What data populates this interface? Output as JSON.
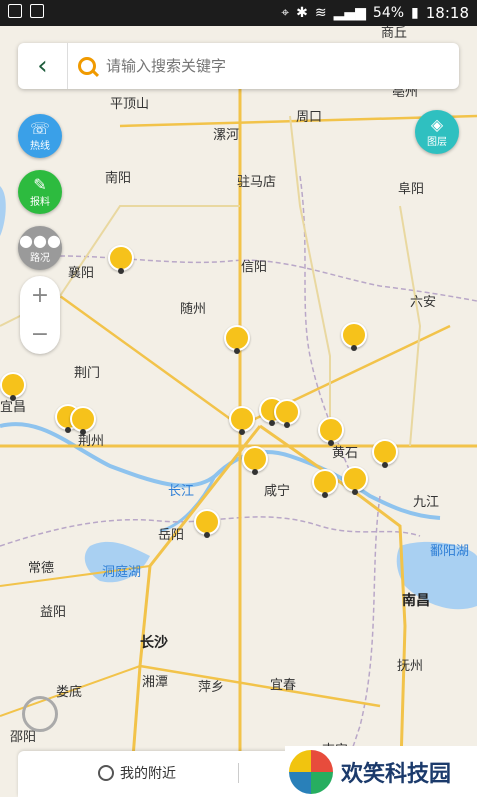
{
  "status_bar": {
    "battery": "54%",
    "time": "18:18"
  },
  "search": {
    "back_icon": "chevron-left-icon",
    "placeholder": "请输入搜索关键字"
  },
  "fabs": {
    "hotline": "热线",
    "report": "报料",
    "traffic": "路况",
    "layers": "图层"
  },
  "zoom": {
    "in": "+",
    "out": "−"
  },
  "cities": [
    {
      "name": "商丘",
      "big": false
    },
    {
      "name": "亳州",
      "big": false
    },
    {
      "name": "平顶山",
      "big": false
    },
    {
      "name": "周口",
      "big": false
    },
    {
      "name": "漯河",
      "big": false
    },
    {
      "name": "南阳",
      "big": false
    },
    {
      "name": "驻马店",
      "big": false
    },
    {
      "name": "阜阳",
      "big": false
    },
    {
      "name": "襄阳",
      "big": false
    },
    {
      "name": "信阳",
      "big": false
    },
    {
      "name": "随州",
      "big": false
    },
    {
      "name": "六安",
      "big": false
    },
    {
      "name": "荆门",
      "big": false
    },
    {
      "name": "宜昌",
      "big": false
    },
    {
      "name": "荆州",
      "big": false
    },
    {
      "name": "黄石",
      "big": false
    },
    {
      "name": "咸宁",
      "big": false
    },
    {
      "name": "九江",
      "big": false
    },
    {
      "name": "岳阳",
      "big": false
    },
    {
      "name": "常德",
      "big": false
    },
    {
      "name": "益阳",
      "big": false
    },
    {
      "name": "长沙",
      "big": true
    },
    {
      "name": "南昌",
      "big": true
    },
    {
      "name": "抚州",
      "big": false
    },
    {
      "name": "湘潭",
      "big": false
    },
    {
      "name": "萍乡",
      "big": false
    },
    {
      "name": "宜春",
      "big": false
    },
    {
      "name": "娄底",
      "big": false
    },
    {
      "name": "邵阳",
      "big": false
    },
    {
      "name": "吉安",
      "big": false
    }
  ],
  "water_labels": {
    "yangtze": "长江",
    "dongting": "洞庭湖",
    "poyang": "鄱阳湖"
  },
  "bottom": {
    "nearby": "我的附近"
  },
  "watermark": "欢笑科技园"
}
